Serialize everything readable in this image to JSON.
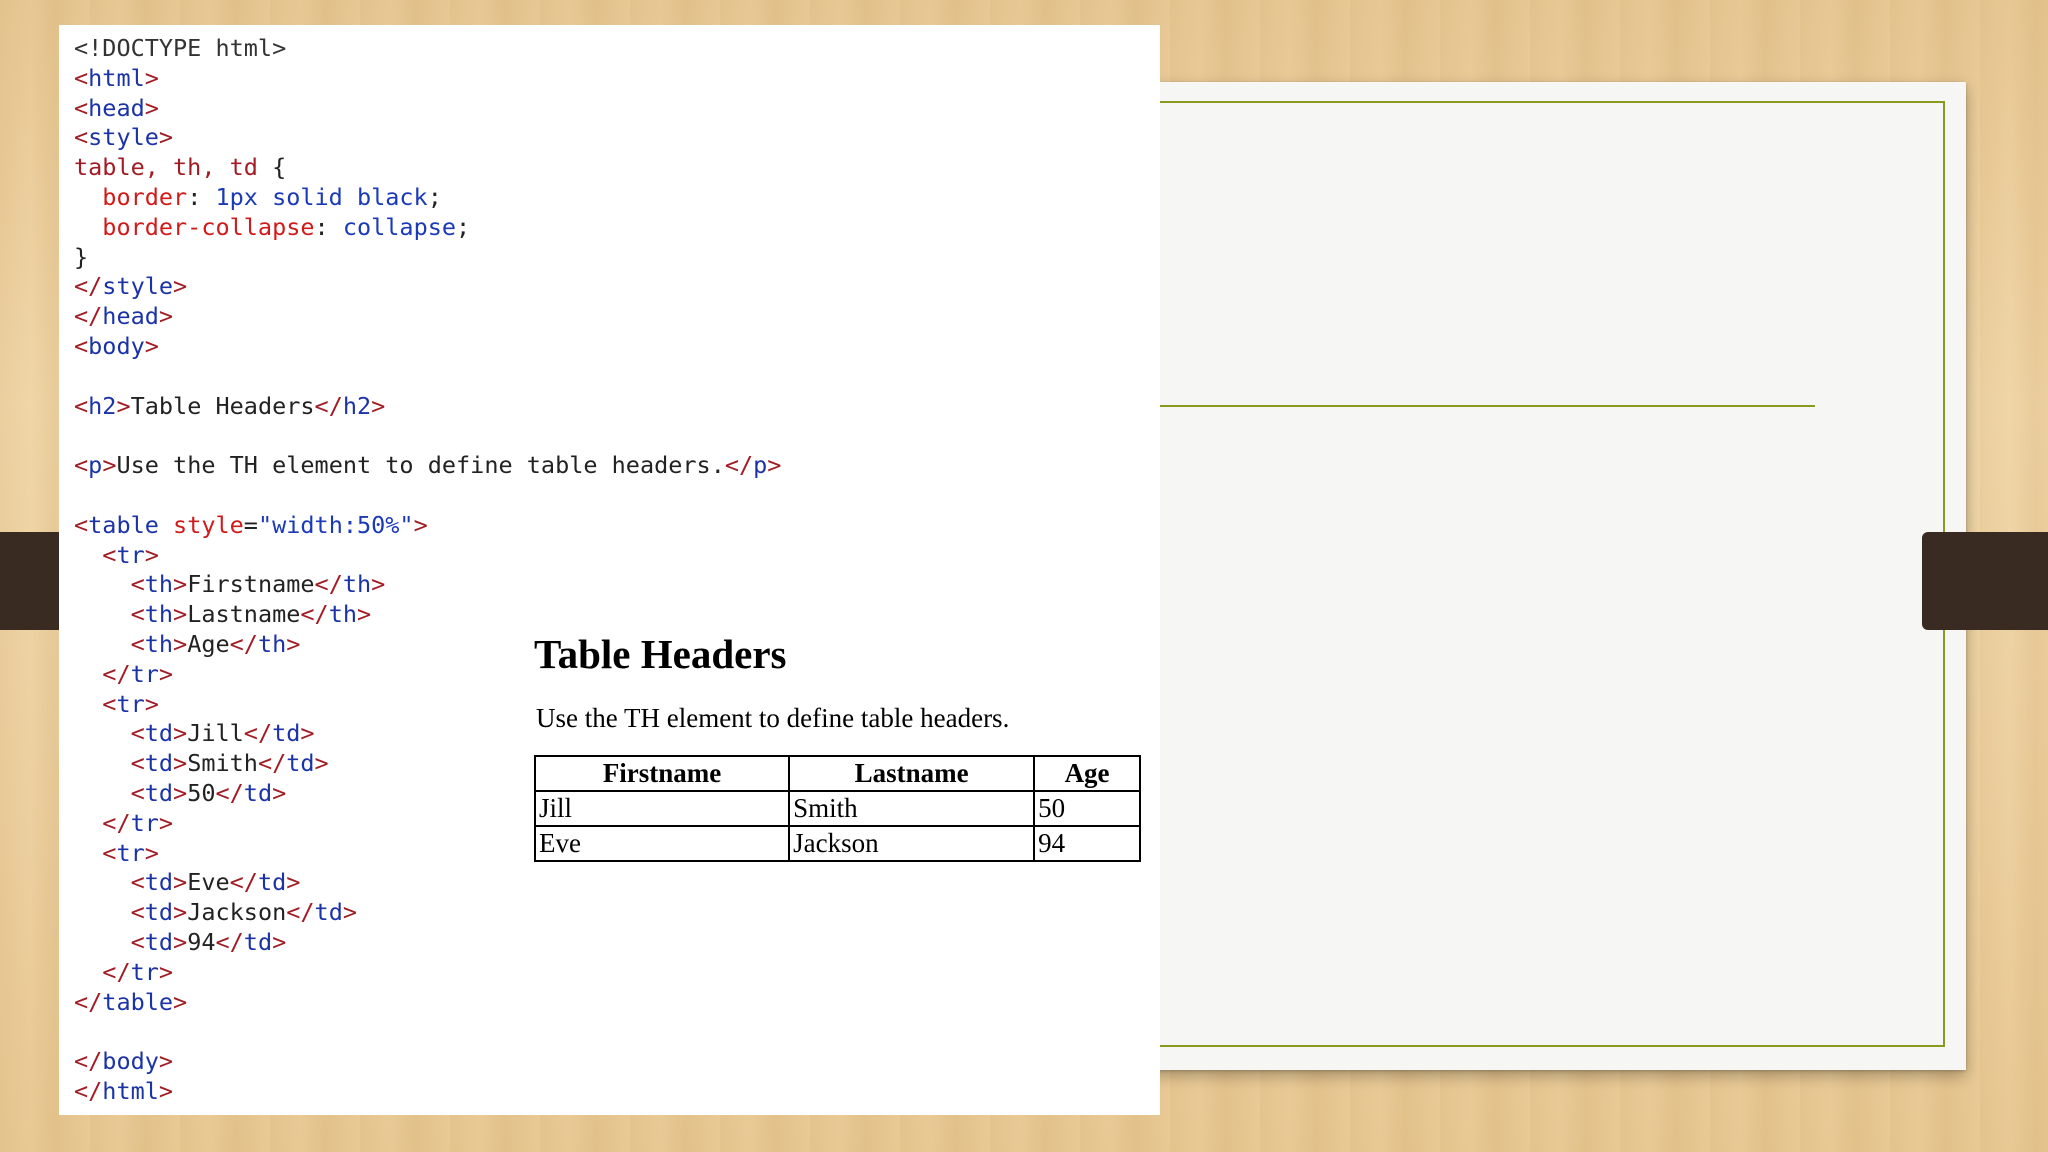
{
  "code_lines": [
    [
      {
        "t": "<!DOCTYPE html>",
        "c": "pc"
      }
    ],
    [
      {
        "t": "<",
        "c": "tg"
      },
      {
        "t": "html",
        "c": "tn"
      },
      {
        "t": ">",
        "c": "tg"
      }
    ],
    [
      {
        "t": "<",
        "c": "tg"
      },
      {
        "t": "head",
        "c": "tn"
      },
      {
        "t": ">",
        "c": "tg"
      }
    ],
    [
      {
        "t": "<",
        "c": "tg"
      },
      {
        "t": "style",
        "c": "tn"
      },
      {
        "t": ">",
        "c": "tg"
      }
    ],
    [
      {
        "t": "table, th, td ",
        "c": "tg"
      },
      {
        "t": "{",
        "c": "tx"
      }
    ],
    [
      {
        "t": "  ",
        "c": "tx"
      },
      {
        "t": "border",
        "c": "pr"
      },
      {
        "t": ": ",
        "c": "tx"
      },
      {
        "t": "1px solid black",
        "c": "vl"
      },
      {
        "t": ";",
        "c": "tx"
      }
    ],
    [
      {
        "t": "  ",
        "c": "tx"
      },
      {
        "t": "border-collapse",
        "c": "pr"
      },
      {
        "t": ": ",
        "c": "tx"
      },
      {
        "t": "collapse",
        "c": "vl"
      },
      {
        "t": ";",
        "c": "tx"
      }
    ],
    [
      {
        "t": "}",
        "c": "tx"
      }
    ],
    [
      {
        "t": "</",
        "c": "tg"
      },
      {
        "t": "style",
        "c": "tn"
      },
      {
        "t": ">",
        "c": "tg"
      }
    ],
    [
      {
        "t": "</",
        "c": "tg"
      },
      {
        "t": "head",
        "c": "tn"
      },
      {
        "t": ">",
        "c": "tg"
      }
    ],
    [
      {
        "t": "<",
        "c": "tg"
      },
      {
        "t": "body",
        "c": "tn"
      },
      {
        "t": ">",
        "c": "tg"
      }
    ],
    [],
    [
      {
        "t": "<",
        "c": "tg"
      },
      {
        "t": "h2",
        "c": "tn"
      },
      {
        "t": ">",
        "c": "tg"
      },
      {
        "t": "Table Headers",
        "c": "tx"
      },
      {
        "t": "</",
        "c": "tg"
      },
      {
        "t": "h2",
        "c": "tn"
      },
      {
        "t": ">",
        "c": "tg"
      }
    ],
    [],
    [
      {
        "t": "<",
        "c": "tg"
      },
      {
        "t": "p",
        "c": "tn"
      },
      {
        "t": ">",
        "c": "tg"
      },
      {
        "t": "Use the TH element to define table headers.",
        "c": "tx"
      },
      {
        "t": "</",
        "c": "tg"
      },
      {
        "t": "p",
        "c": "tn"
      },
      {
        "t": ">",
        "c": "tg"
      }
    ],
    [],
    [
      {
        "t": "<",
        "c": "tg"
      },
      {
        "t": "table",
        "c": "tn"
      },
      {
        "t": " style",
        "c": "pr"
      },
      {
        "t": "=",
        "c": "tx"
      },
      {
        "t": "\"width:50%\"",
        "c": "vl"
      },
      {
        "t": ">",
        "c": "tg"
      }
    ],
    [
      {
        "t": "  <",
        "c": "tg"
      },
      {
        "t": "tr",
        "c": "tn"
      },
      {
        "t": ">",
        "c": "tg"
      }
    ],
    [
      {
        "t": "    <",
        "c": "tg"
      },
      {
        "t": "th",
        "c": "tn"
      },
      {
        "t": ">",
        "c": "tg"
      },
      {
        "t": "Firstname",
        "c": "tx"
      },
      {
        "t": "</",
        "c": "tg"
      },
      {
        "t": "th",
        "c": "tn"
      },
      {
        "t": ">",
        "c": "tg"
      }
    ],
    [
      {
        "t": "    <",
        "c": "tg"
      },
      {
        "t": "th",
        "c": "tn"
      },
      {
        "t": ">",
        "c": "tg"
      },
      {
        "t": "Lastname",
        "c": "tx"
      },
      {
        "t": "</",
        "c": "tg"
      },
      {
        "t": "th",
        "c": "tn"
      },
      {
        "t": ">",
        "c": "tg"
      }
    ],
    [
      {
        "t": "    <",
        "c": "tg"
      },
      {
        "t": "th",
        "c": "tn"
      },
      {
        "t": ">",
        "c": "tg"
      },
      {
        "t": "Age",
        "c": "tx"
      },
      {
        "t": "</",
        "c": "tg"
      },
      {
        "t": "th",
        "c": "tn"
      },
      {
        "t": ">",
        "c": "tg"
      }
    ],
    [
      {
        "t": "  </",
        "c": "tg"
      },
      {
        "t": "tr",
        "c": "tn"
      },
      {
        "t": ">",
        "c": "tg"
      }
    ],
    [
      {
        "t": "  <",
        "c": "tg"
      },
      {
        "t": "tr",
        "c": "tn"
      },
      {
        "t": ">",
        "c": "tg"
      }
    ],
    [
      {
        "t": "    <",
        "c": "tg"
      },
      {
        "t": "td",
        "c": "tn"
      },
      {
        "t": ">",
        "c": "tg"
      },
      {
        "t": "Jill",
        "c": "tx"
      },
      {
        "t": "</",
        "c": "tg"
      },
      {
        "t": "td",
        "c": "tn"
      },
      {
        "t": ">",
        "c": "tg"
      }
    ],
    [
      {
        "t": "    <",
        "c": "tg"
      },
      {
        "t": "td",
        "c": "tn"
      },
      {
        "t": ">",
        "c": "tg"
      },
      {
        "t": "Smith",
        "c": "tx"
      },
      {
        "t": "</",
        "c": "tg"
      },
      {
        "t": "td",
        "c": "tn"
      },
      {
        "t": ">",
        "c": "tg"
      }
    ],
    [
      {
        "t": "    <",
        "c": "tg"
      },
      {
        "t": "td",
        "c": "tn"
      },
      {
        "t": ">",
        "c": "tg"
      },
      {
        "t": "50",
        "c": "tx"
      },
      {
        "t": "</",
        "c": "tg"
      },
      {
        "t": "td",
        "c": "tn"
      },
      {
        "t": ">",
        "c": "tg"
      }
    ],
    [
      {
        "t": "  </",
        "c": "tg"
      },
      {
        "t": "tr",
        "c": "tn"
      },
      {
        "t": ">",
        "c": "tg"
      }
    ],
    [
      {
        "t": "  <",
        "c": "tg"
      },
      {
        "t": "tr",
        "c": "tn"
      },
      {
        "t": ">",
        "c": "tg"
      }
    ],
    [
      {
        "t": "    <",
        "c": "tg"
      },
      {
        "t": "td",
        "c": "tn"
      },
      {
        "t": ">",
        "c": "tg"
      },
      {
        "t": "Eve",
        "c": "tx"
      },
      {
        "t": "</",
        "c": "tg"
      },
      {
        "t": "td",
        "c": "tn"
      },
      {
        "t": ">",
        "c": "tg"
      }
    ],
    [
      {
        "t": "    <",
        "c": "tg"
      },
      {
        "t": "td",
        "c": "tn"
      },
      {
        "t": ">",
        "c": "tg"
      },
      {
        "t": "Jackson",
        "c": "tx"
      },
      {
        "t": "</",
        "c": "tg"
      },
      {
        "t": "td",
        "c": "tn"
      },
      {
        "t": ">",
        "c": "tg"
      }
    ],
    [
      {
        "t": "    <",
        "c": "tg"
      },
      {
        "t": "td",
        "c": "tn"
      },
      {
        "t": ">",
        "c": "tg"
      },
      {
        "t": "94",
        "c": "tx"
      },
      {
        "t": "</",
        "c": "tg"
      },
      {
        "t": "td",
        "c": "tn"
      },
      {
        "t": ">",
        "c": "tg"
      }
    ],
    [
      {
        "t": "  </",
        "c": "tg"
      },
      {
        "t": "tr",
        "c": "tn"
      },
      {
        "t": ">",
        "c": "tg"
      }
    ],
    [
      {
        "t": "</",
        "c": "tg"
      },
      {
        "t": "table",
        "c": "tn"
      },
      {
        "t": ">",
        "c": "tg"
      }
    ],
    [],
    [
      {
        "t": "</",
        "c": "tg"
      },
      {
        "t": "body",
        "c": "tn"
      },
      {
        "t": ">",
        "c": "tg"
      }
    ],
    [
      {
        "t": "</",
        "c": "tg"
      },
      {
        "t": "html",
        "c": "tn"
      },
      {
        "t": ">",
        "c": "tg"
      }
    ]
  ],
  "preview": {
    "title": "Table Headers",
    "paragraph": "Use the TH element to define table headers.",
    "headers": [
      "Firstname",
      "Lastname",
      "Age"
    ],
    "rows": [
      [
        "Jill",
        "Smith",
        "50"
      ],
      [
        "Eve",
        "Jackson",
        "94"
      ]
    ]
  },
  "colors": {
    "tag": "#a11c24",
    "tag_name": "#1c33a8",
    "property": "#d11a1a",
    "value": "#1a3ab8",
    "accent_line": "#8a9a1f",
    "band": "#3a2b22"
  }
}
